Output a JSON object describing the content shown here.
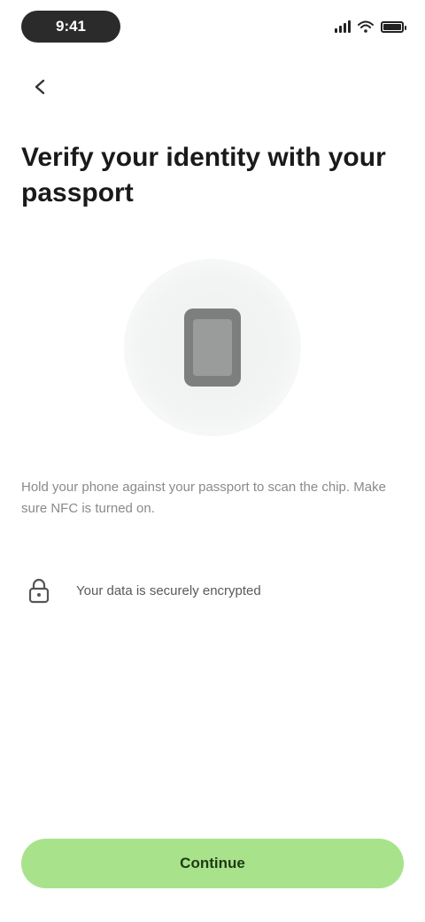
{
  "status_bar": {
    "time": "9:41"
  },
  "header": {
    "back_icon": "arrow-left-icon"
  },
  "title": "Verify your identity with your passport",
  "illustration": {
    "icon": "phone-icon"
  },
  "description": "Hold your phone against your passport to scan the chip. Make sure NFC is turned on.",
  "info": {
    "icon": "lock-icon",
    "text": "Your data is securely encrypted"
  },
  "actions": {
    "continue_label": "Continue"
  },
  "colors": {
    "accent": "#a8e38c",
    "title": "#1a1a1a",
    "muted": "#8a8a8a"
  }
}
